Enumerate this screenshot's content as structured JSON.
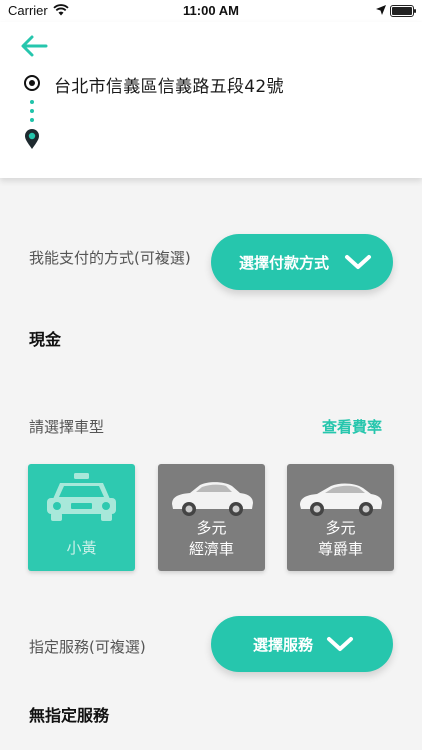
{
  "status_bar": {
    "carrier": "Carrier",
    "time": "11:00 AM"
  },
  "header": {
    "back_icon": "arrow-left-icon",
    "address": "台北市信義區信義路五段42號"
  },
  "payment": {
    "label": "我能支付的方式(可複選)",
    "button_label": "選擇付款方式",
    "selected_value": "現金"
  },
  "car_type": {
    "label": "請選擇車型",
    "rate_link": "查看費率",
    "options": [
      {
        "label": "小黃",
        "selected": true,
        "icon": "taxi-icon"
      },
      {
        "line1": "多元",
        "line2": "經濟車",
        "selected": false,
        "icon": "sedan-icon"
      },
      {
        "line1": "多元",
        "line2": "尊爵車",
        "selected": false,
        "icon": "luxury-sedan-icon"
      }
    ]
  },
  "service": {
    "label": "指定服務(可複選)",
    "button_label": "選擇服務",
    "selected_value": "無指定服務"
  },
  "colors": {
    "accent": "#26c6ad",
    "selected_card": "#2ec9b0",
    "unselected_card": "#7d7d7d",
    "background": "#f4f4f4"
  }
}
